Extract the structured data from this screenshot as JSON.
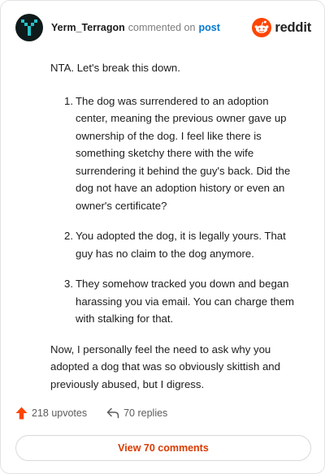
{
  "colors": {
    "accent": "#d93a00",
    "link": "#0079d3",
    "upvote": "#ff4500",
    "avatar_bg": "#0f1a1a",
    "avatar_pixels": "#25c3c8"
  },
  "header": {
    "username": "Yerm_Terragon",
    "commented_text": "commented on",
    "post_link": "post",
    "brand": "reddit",
    "brand_icon": "reddit-alien-icon",
    "avatar_icon": "pixel-y-avatar"
  },
  "comment": {
    "intro": "NTA. Let's break this down.",
    "items": [
      {
        "num": "1.",
        "text": "The dog was surrendered to an adoption center, meaning the previous owner gave up ownership of the dog. I feel like there is something sketchy there with the wife surrendering it behind the guy's back. Did the dog not have an adoption history or even an owner's certificate?"
      },
      {
        "num": "2.",
        "text": "You adopted the dog, it is legally yours. That guy has no claim to the dog anymore."
      },
      {
        "num": "3.",
        "text": "They somehow tracked you down and began harassing you via email. You can charge them with stalking for that."
      }
    ],
    "outro": "Now, I personally feel the need to ask why you adopted a dog that was so obviously skittish and previously abused, but I digress."
  },
  "footer": {
    "upvotes": "218 upvotes",
    "upvote_icon": "upvote-arrow-icon",
    "replies": "70 replies",
    "reply_icon": "reply-arrow-icon",
    "view_button": "View 70 comments"
  }
}
